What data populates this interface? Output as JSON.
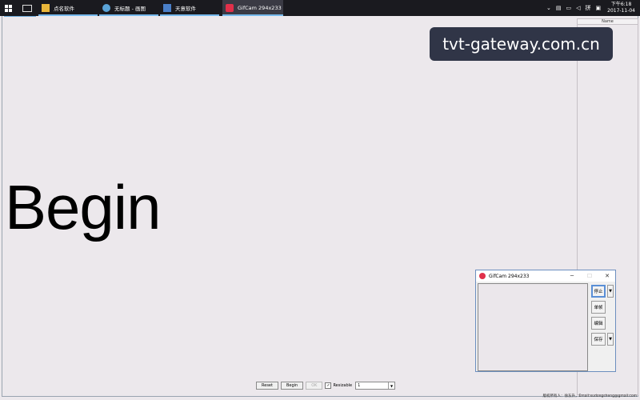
{
  "taskbar": {
    "apps": [
      {
        "label": "点名软件",
        "icon": "folder-icon",
        "color": "#e9b63a"
      },
      {
        "label": "无标题 - 画图",
        "icon": "paint-icon",
        "color": "#5aa3d8"
      },
      {
        "label": "天意软件",
        "icon": "document-icon",
        "color": "#4a7fc8"
      },
      {
        "label": "GifCam 294x233",
        "icon": "gifcam-icon",
        "color": "#e0304a"
      }
    ],
    "clock_time": "下午6:18",
    "clock_date": "2017-11-04"
  },
  "main": {
    "big_text": "Begin",
    "panel_header": "Name"
  },
  "watermark": "tvt-gateway.com.cn",
  "controls": {
    "reset": "Reset",
    "begin": "Begin",
    "ok": "OK",
    "checkbox_label": "Resizable",
    "combo_value": "1"
  },
  "copyright": "版权所有人：徐东升，Email:xudongsheng@gmail.com",
  "gifcam": {
    "title": "GifCam 294x233",
    "stop": "停止",
    "frame": "单帧",
    "edit": "编辑",
    "save": "保存"
  }
}
